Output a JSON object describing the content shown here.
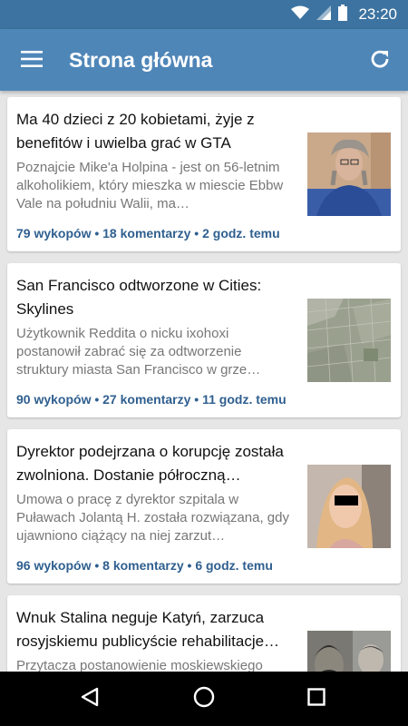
{
  "status_bar": {
    "time": "23:20"
  },
  "app_bar": {
    "title": "Strona główna"
  },
  "articles": [
    {
      "title": "Ma 40 dzieci z 20 kobietami, żyje z benefitów i uwielba grać w GTA",
      "description": "Poznajcie Mike'a Holpina - jest on 56-letnim alkoholikiem, który mieszka w miescie Ebbw Vale na południu Walii, ma…",
      "meta": "79 wykopów • 18 komentarzy • 2 godz. temu"
    },
    {
      "title": "San Francisco odtworzone w Cities: Skylines",
      "description": "Użytkownik Reddita o nicku ixohoxi postanowił zabrać się za odtworzenie struktury miasta San Francisco w grze…",
      "meta": "90 wykopów • 27 komentarzy • 11 godz. temu"
    },
    {
      "title": "Dyrektor podejrzana o korupcję została zwolniona. Dostanie półroczną…",
      "description": "Umowa o pracę z dyrektor szpitala w Puławach Jolantą H. została rozwiązana, gdy ujawniono ciążący na niej zarzut…",
      "meta": "96 wykopów • 8 komentarzy • 6 godz. temu"
    },
    {
      "title": "Wnuk Stalina neguje Katyń, zarzuca rosyjskiemu publicyście rehabilitacje…",
      "description": "Przytacza postanowienie moskiewskiego",
      "meta": ""
    }
  ],
  "icons": {
    "menu": "hamburger-menu-icon",
    "refresh": "refresh-icon",
    "back": "back-icon",
    "home": "home-icon",
    "recents": "recents-icon"
  },
  "colors": {
    "status_bar": "#3d73a0",
    "app_bar": "#4f86b8",
    "meta_text": "#2f5f8f",
    "background": "#e6e6e6"
  }
}
